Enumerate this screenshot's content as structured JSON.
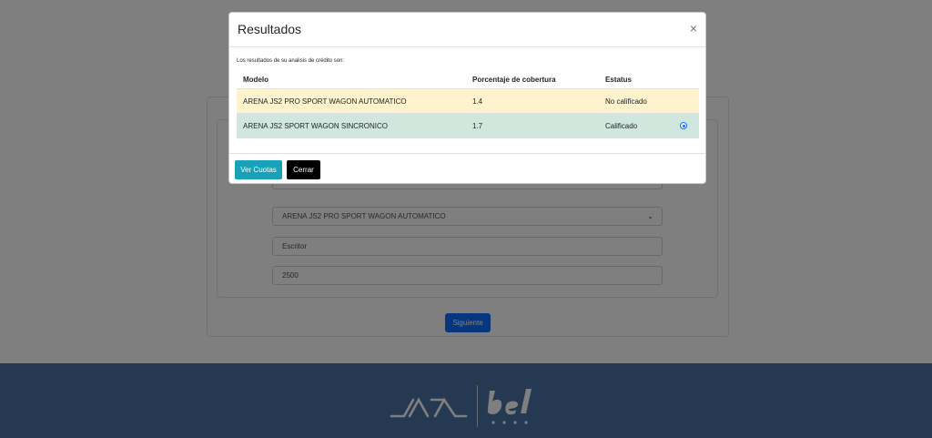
{
  "form": {
    "model_select": "ARENA JS2 PRO SPORT WAGON AUTOMATICO",
    "occupation_field": "Escritor",
    "amount_field": "2500",
    "next_button": "Siguiente"
  },
  "modal": {
    "title": "Resultados",
    "close_label": "×",
    "intro": "Los resultados de su analisis de crédito son:",
    "headers": {
      "model": "Modelo",
      "coverage": "Porcentaje de cobertura",
      "status": "Estatus"
    },
    "rows": [
      {
        "model": "ARENA JS2 PRO SPORT WAGON AUTOMATICO",
        "coverage": "1.4",
        "status": "No calificado",
        "color": "#fff3cd",
        "selected": false
      },
      {
        "model": "ARENA JS2 SPORT WAGON SINCRONICO",
        "coverage": "1.7",
        "status": "Calificado",
        "color": "#d1e7dd",
        "selected": true
      }
    ],
    "buttons": {
      "quotas": "Ver Cuotas",
      "close": "Cerrar"
    }
  },
  "colors": {
    "footer": "#4c72a6",
    "primary": "#0d6efd",
    "info": "#17a2b8"
  },
  "icons": {
    "close": "close-icon",
    "select": "chevron-down-icon",
    "radio": "radio-selected-icon"
  }
}
